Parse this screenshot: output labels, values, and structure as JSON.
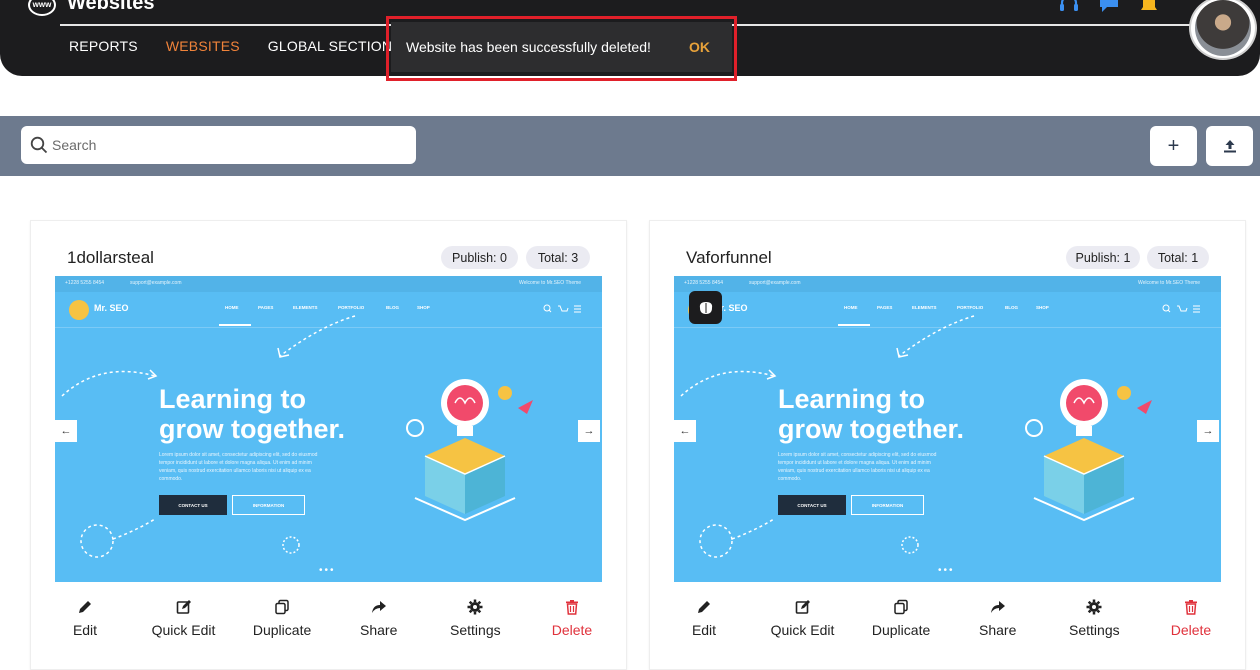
{
  "header": {
    "brand_icon": "www",
    "title": "Websites",
    "nav": [
      {
        "label": "REPORTS",
        "active": false
      },
      {
        "label": "WEBSITES",
        "active": true
      },
      {
        "label": "GLOBAL SECTIONS",
        "active": false
      }
    ],
    "icons": [
      "support-headset-icon",
      "chat-icon",
      "bell-icon"
    ],
    "accent_color": "#f0833a"
  },
  "toast": {
    "message": "Website has been successfully deleted!",
    "ok_label": "OK"
  },
  "toolbar": {
    "search_placeholder": "Search",
    "add_label": "+",
    "upload_label": "upload"
  },
  "preview": {
    "topbar_phone": "+1228 5255 8454",
    "topbar_email": "support@example.com",
    "topbar_right": "Welcome to Mr.SEO Theme",
    "brand": "Mr. SEO",
    "menu": [
      "HOME",
      "PAGES",
      "ELEMENTS",
      "PORTFOLIO",
      "BLOG",
      "SHOP"
    ],
    "headline_1": "Learning to",
    "headline_2": "grow together.",
    "paragraph": "Lorem ipsum dolor sit amet, consectetur adipiscing elit, sed do eiusmod tempor incididunt ut labore et dolore magna aliqua. Ut enim ad minim veniam, quis nostrud exercitation ullamco laboris nisi ut aliquip ex ea commodo.",
    "btn_contact": "CONTACT US",
    "btn_info": "INFORMATION",
    "prev_arrow": "←",
    "next_arrow": "→",
    "dots": "•••"
  },
  "sites": [
    {
      "name": "1dollarsteal",
      "publish": "Publish: 0",
      "total": "Total: 3"
    },
    {
      "name": "Vaforfunnel",
      "publish": "Publish: 1",
      "total": "Total: 1"
    }
  ],
  "actions": {
    "edit": "Edit",
    "quick_edit": "Quick Edit",
    "duplicate": "Duplicate",
    "share": "Share",
    "settings": "Settings",
    "delete": "Delete"
  },
  "colors": {
    "delete": "#e0323c",
    "toast_ok": "#e8a23a",
    "toolbar_band": "#6d7a8e",
    "preview_sky": "#58bdf4"
  }
}
